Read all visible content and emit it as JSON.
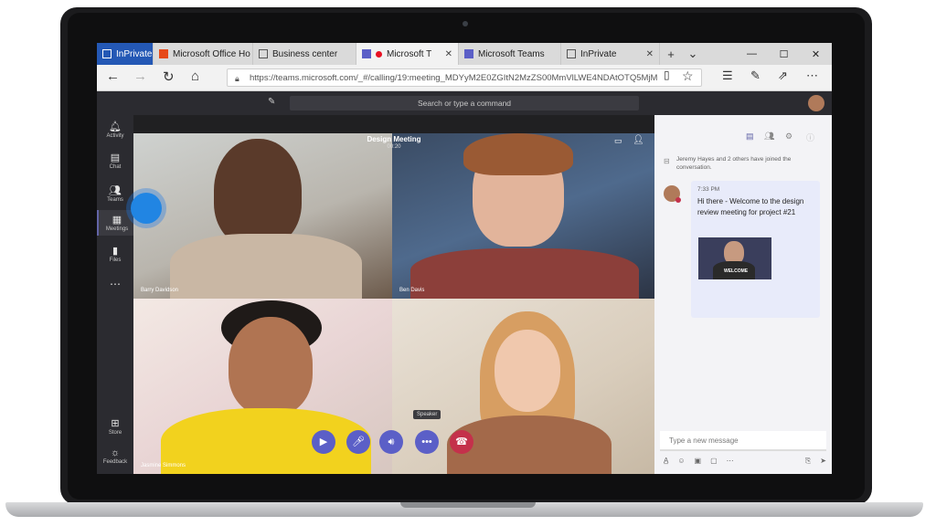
{
  "browser": {
    "tabs": [
      {
        "label": "InPrivate"
      },
      {
        "label": "Microsoft Office Ho"
      },
      {
        "label": "Business center"
      },
      {
        "label": "Microsoft T"
      },
      {
        "label": "Microsoft Teams"
      },
      {
        "label": "InPrivate"
      }
    ],
    "url": "https://teams.microsoft.com/_#/calling/19:meeting_MDYyM2E0ZGItN2MzZS00MmVlLWE4NDAtOTQ5MjM"
  },
  "teams": {
    "search_placeholder": "Search or type a command",
    "rail": [
      {
        "label": "Activity",
        "icon": "bell-icon"
      },
      {
        "label": "Chat",
        "icon": "chat-icon"
      },
      {
        "label": "Teams",
        "icon": "teams-icon"
      },
      {
        "label": "Meetings",
        "icon": "calendar-icon"
      },
      {
        "label": "Files",
        "icon": "file-icon"
      },
      {
        "label": "Store",
        "icon": "store-icon"
      },
      {
        "label": "Feedback",
        "icon": "feedback-icon"
      }
    ],
    "meeting": {
      "title": "Design Meeting",
      "time": "00:20",
      "participants": [
        "Barry Davidson",
        "Ben Davis",
        "Jasmine Simmons",
        ""
      ],
      "tooltip": "Speaker"
    },
    "chat": {
      "system_text": "Jeremy Hayes and 2 others have joined the conversation.",
      "message_time": "7:33 PM",
      "message_text": "Hi there - Welcome to the design review meeting for project #21",
      "thumbnail_label": "WELCOME",
      "compose_placeholder": "Type a new message"
    }
  },
  "colors": {
    "accent": "#6264a7",
    "hangup": "#c4314b",
    "inprivate": "#2458b5"
  }
}
